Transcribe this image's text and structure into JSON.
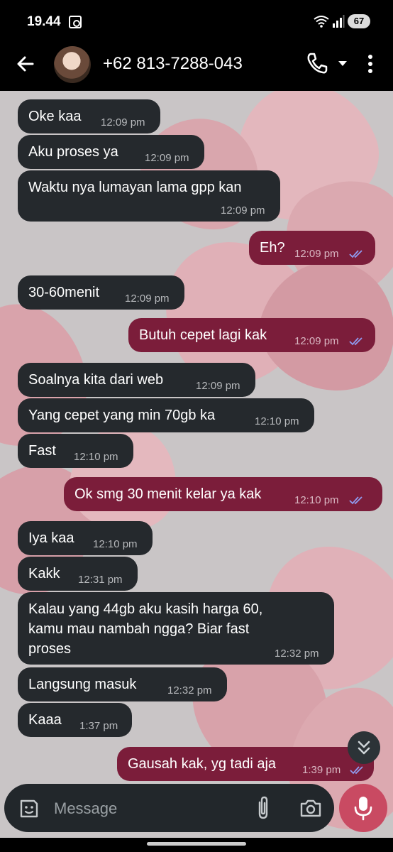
{
  "status": {
    "time": "19.44",
    "battery": "67"
  },
  "header": {
    "contact": "+62 813-7288-043"
  },
  "messages": [
    {
      "text": "Oke kaa",
      "time": "12:09 pm"
    },
    {
      "text": "Aku proses ya",
      "time": "12:09 pm"
    },
    {
      "text": "Waktu nya lumayan lama gpp kan",
      "time": "12:09 pm"
    },
    {
      "text": "Eh?",
      "time": "12:09 pm"
    },
    {
      "text": "30-60menit",
      "time": "12:09 pm"
    },
    {
      "text": "Butuh cepet lagi kak",
      "time": "12:09 pm"
    },
    {
      "text": "Soalnya kita dari web",
      "time": "12:09 pm"
    },
    {
      "text": "Yang cepet yang min 70gb ka",
      "time": "12:10 pm"
    },
    {
      "text": "Fast",
      "time": "12:10 pm"
    },
    {
      "text": "Ok smg 30 menit kelar ya kak",
      "time": "12:10 pm"
    },
    {
      "text": "Iya kaa",
      "time": "12:10 pm"
    },
    {
      "text": "Kakk",
      "time": "12:31 pm"
    },
    {
      "text": "Kalau yang 44gb aku kasih harga 60,\nkamu mau nambah ngga? Biar fast\nproses",
      "time": "12:32 pm"
    },
    {
      "text": "Langsung masuk",
      "time": "12:32 pm"
    },
    {
      "text": "Kaaa",
      "time": "1:37 pm"
    },
    {
      "text": "Gausah kak, yg tadi aja",
      "time": "1:39 pm"
    }
  ],
  "composer": {
    "placeholder": "Message"
  },
  "colors": {
    "incoming": "#25292d",
    "outgoing": "#7b1d3a",
    "mic": "#c94a62",
    "read_ticks": "#8f9cf0"
  }
}
